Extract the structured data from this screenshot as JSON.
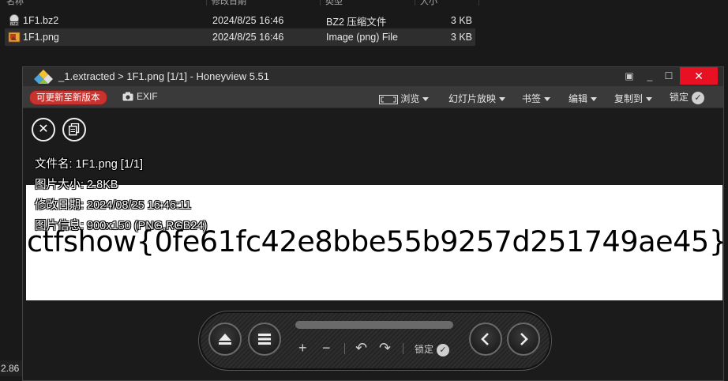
{
  "explorer": {
    "rows": [
      {
        "name": "1F1.bz2",
        "date": "2024/8/25 16:46",
        "type": "BZ2 压缩文件",
        "size": "3 KB",
        "selected": false
      },
      {
        "name": "1F1.png",
        "date": "2024/8/25 16:46",
        "type": "Image (png) File",
        "size": "3 KB",
        "selected": true
      }
    ],
    "status_left": "2.86 I"
  },
  "viewer": {
    "title": "_1.extracted > 1F1.png [1/1] - Honeyview 5.51",
    "window_controls": {
      "compact": "▣",
      "minimize": "_",
      "maximize": "☐",
      "close": "✕"
    },
    "toolbar": {
      "update_label": "可更新至新版本",
      "exif_label": "EXIF",
      "browse_label": "浏览",
      "slideshow_label": "幻灯片放映",
      "bookmark_label": "书签",
      "edit_label": "编辑",
      "copy_to_label": "复制到",
      "lock_label": "锁定"
    },
    "info": {
      "filename": "文件名: 1F1.png [1/1]",
      "filesize": "图片大小: 2.8KB",
      "modified": "修改日期: 2024/08/25 16:46:11",
      "imageinfo": "图片信息: 900x150 (PNG,RGB24)"
    },
    "image_text": "ctfshow{0fe61fc42e8bbe55b9257d251749ae45}",
    "panel": {
      "lock_label": "锁定"
    }
  },
  "colors": {
    "accent_red": "#c8332f",
    "close_red": "#e81123",
    "toolbar_bg": "#3a3a3a",
    "title_bg": "#2d2d2d"
  },
  "icons": [
    "bz2-file-icon",
    "png-file-icon",
    "honeyview-app-icon",
    "camera-icon",
    "close-circle-icon",
    "copy-icon",
    "eject-icon",
    "menu-icon",
    "prev-icon",
    "next-icon",
    "zoom-in-icon",
    "zoom-out-icon",
    "rotate-left-icon",
    "rotate-right-icon",
    "check-icon"
  ]
}
